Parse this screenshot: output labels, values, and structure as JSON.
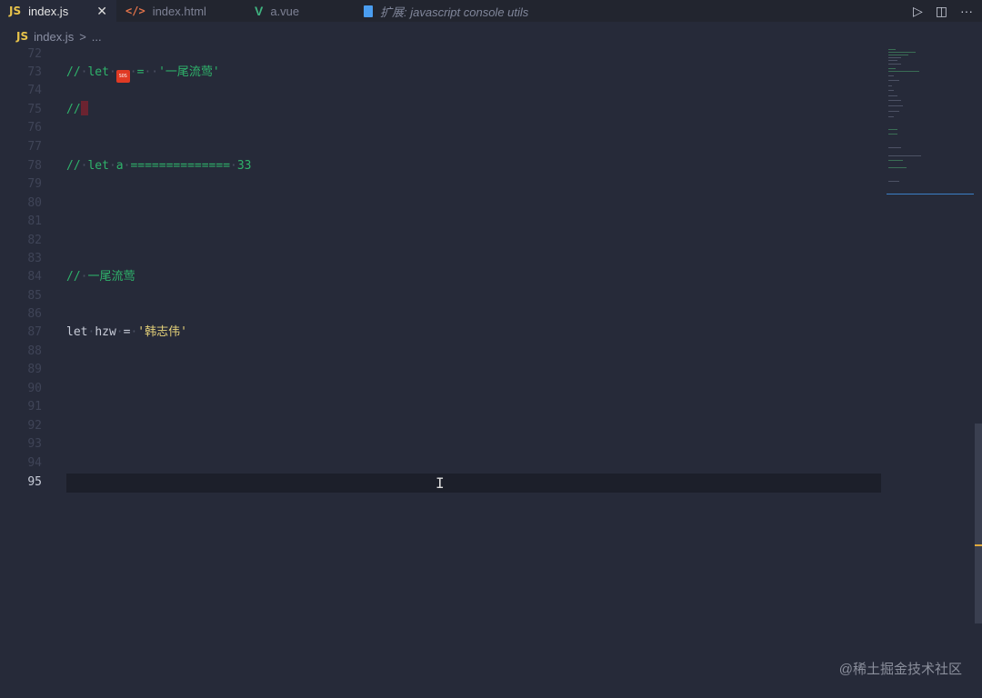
{
  "tabs": [
    {
      "label": "index.js",
      "badge": "JS",
      "close": "✕",
      "active": true
    },
    {
      "label": "index.html",
      "badge": "</>"
    },
    {
      "label": "a.vue",
      "badge": "V"
    },
    {
      "label": "扩展: javascript console utils"
    }
  ],
  "tab_actions": {
    "run": "▷",
    "split": "◫",
    "more": "···"
  },
  "breadcrumb": {
    "badge": "JS",
    "file": "index.js",
    "sep": ">",
    "more": "..."
  },
  "gutter": [
    "72",
    "73",
    "74",
    "75",
    "76",
    "77",
    "78",
    "79",
    "80",
    "81",
    "82",
    "83",
    "84",
    "85",
    "86",
    "87",
    "88",
    "89",
    "90",
    "91",
    "92",
    "93",
    "94",
    "95"
  ],
  "current_line": "95",
  "code": {
    "line73": {
      "comment": "//",
      "let": "let",
      "eq": "=",
      "str": "'一尾流莺'",
      "emoji_text": "SOS"
    },
    "line75": {
      "comment": "//"
    },
    "line78": {
      "comment": "//",
      "let": "let",
      "var": "a",
      "eqs": "==============",
      "num": "33"
    },
    "line84": {
      "comment": "//",
      "text": "一尾流莺"
    },
    "line87": {
      "kw": "let",
      "var": "hzw",
      "eq": "=",
      "str": "'韩志伟'"
    }
  },
  "watermark": "@稀土掘金技术社区",
  "colors": {
    "background": "#262a39",
    "comment": "#2fb36b",
    "string": "#e6d27a",
    "accent": "#3b7fc6"
  }
}
